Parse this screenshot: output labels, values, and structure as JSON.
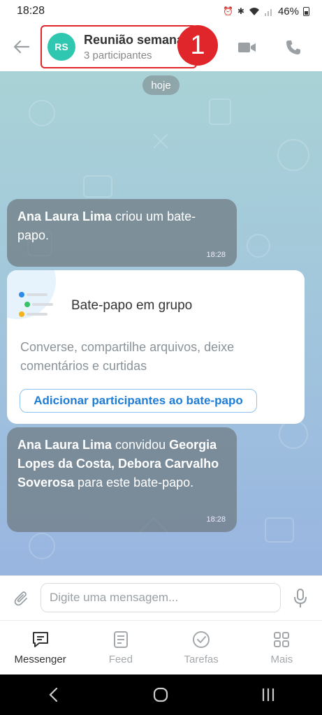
{
  "status_bar": {
    "time": "18:28",
    "battery": "46%"
  },
  "header": {
    "avatar_initials": "RS",
    "title": "Reunião semanal",
    "subtitle": "3 participantes",
    "step_number": "1"
  },
  "chat": {
    "date_pill": "hoje",
    "messages": [
      {
        "author": "Ana Laura Lima",
        "text": " criou um bate-papo.",
        "time": "18:28"
      },
      {
        "author": "Ana Laura Lima",
        "text_1": " convidou ",
        "invitees": "Georgia Lopes da Costa, Debora Carvalho Soverosa",
        "text_2": " para este bate-papo.",
        "time": "18:28"
      }
    ],
    "card": {
      "title": "Bate-papo em grupo",
      "description": "Converse, compartilhe arquivos, deixe comentários e curtidas",
      "button": "Adicionar participantes ao bate-papo"
    }
  },
  "input": {
    "placeholder": "Digite uma mensagem..."
  },
  "bottom_nav": [
    {
      "label": "Messenger",
      "icon": "messenger-icon",
      "active": true
    },
    {
      "label": "Feed",
      "icon": "feed-icon",
      "active": false
    },
    {
      "label": "Tarefas",
      "icon": "tasks-icon",
      "active": false
    },
    {
      "label": "Mais",
      "icon": "more-icon",
      "active": false
    }
  ],
  "colors": {
    "accent": "#1e7dd6",
    "avatar": "#2fc7b0",
    "highlight": "#e0262b"
  }
}
